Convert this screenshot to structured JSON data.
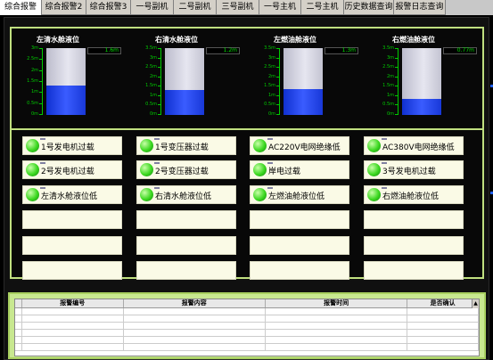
{
  "tabs": [
    {
      "label": "综合报警",
      "active": true
    },
    {
      "label": "综合报警2",
      "active": false
    },
    {
      "label": "综合报警3",
      "active": false
    },
    {
      "label": "一号副机",
      "active": false
    },
    {
      "label": "二号副机",
      "active": false
    },
    {
      "label": "三号副机",
      "active": false
    },
    {
      "label": "一号主机",
      "active": false
    },
    {
      "label": "二号主机",
      "active": false
    },
    {
      "label": "历史数据查询",
      "active": false
    },
    {
      "label": "报警日志查询",
      "active": false
    }
  ],
  "tanks": [
    {
      "title": "左清水舱液位",
      "value": "1.6m",
      "level": 0.44,
      "scale": [
        "3m",
        "2.5m",
        "2m",
        "1.5m",
        "1m",
        "0.5m",
        "0m"
      ]
    },
    {
      "title": "右清水舱液位",
      "value": "1.2m",
      "level": 0.37,
      "scale": [
        "3.5m",
        "3m",
        "2.5m",
        "2m",
        "1.5m",
        "1m",
        "0.5m",
        "0m"
      ]
    },
    {
      "title": "左燃油舱液位",
      "value": "1.3m",
      "level": 0.39,
      "scale": [
        "3.5m",
        "3m",
        "2.5m",
        "2m",
        "1.5m",
        "1m",
        "0.5m",
        "0m"
      ]
    },
    {
      "title": "右燃油舱液位",
      "value": "0.77m",
      "level": 0.24,
      "scale": [
        "3.5m",
        "3m",
        "2.5m",
        "2m",
        "1.5m",
        "1m",
        "0.5m",
        "0m"
      ]
    }
  ],
  "alarms": [
    [
      "1号发电机过载",
      "1号变压器过载",
      "AC220V电网绝缘低",
      "AC380V电网绝缘低"
    ],
    [
      "2号发电机过载",
      "2号变压器过载",
      "岸电过载",
      "3号发电机过载"
    ],
    [
      "左清水舱液位低",
      "右清水舱液位低",
      "左燃油舱液位低",
      "右燃油舱液位低"
    ],
    [
      "",
      "",
      "",
      ""
    ],
    [
      "",
      "",
      "",
      ""
    ],
    [
      "",
      "",
      "",
      ""
    ]
  ],
  "table": {
    "headers": [
      "报警编号",
      "报警内容",
      "报警时间",
      "是否确认"
    ]
  },
  "colors": {
    "led": "#3cd820",
    "tank_fill": "#2a48f0",
    "panel_border": "#c0e080",
    "scale": "#00cc00"
  }
}
